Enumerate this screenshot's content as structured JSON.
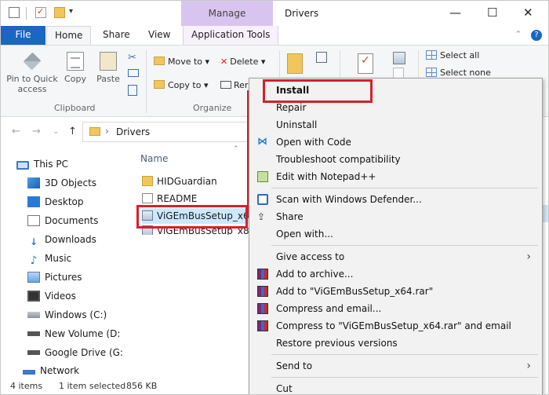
{
  "window": {
    "title": "Drivers",
    "manage_label": "Manage",
    "minimize": "—",
    "maximize": "☐",
    "close": "✕"
  },
  "ribbon_tabs": {
    "file": "File",
    "home": "Home",
    "share": "Share",
    "view": "View",
    "app_tools": "Application Tools"
  },
  "ribbon": {
    "pin": "Pin to Quick access",
    "copy": "Copy",
    "paste": "Paste",
    "move_to": "Move to",
    "delete": "Delete",
    "copy_to": "Copy to",
    "rename": "Rer",
    "select_all": "Select all",
    "select_none": "Select none",
    "group_clipboard": "Clipboard",
    "group_organize": "Organize"
  },
  "address": {
    "path": "Drivers"
  },
  "navpane": {
    "items": [
      {
        "label": "This PC",
        "icon": "computer-icon"
      },
      {
        "label": "3D Objects",
        "icon": "cube-icon"
      },
      {
        "label": "Desktop",
        "icon": "desktop-icon"
      },
      {
        "label": "Documents",
        "icon": "document-icon"
      },
      {
        "label": "Downloads",
        "icon": "download-icon"
      },
      {
        "label": "Music",
        "icon": "music-icon"
      },
      {
        "label": "Pictures",
        "icon": "pictures-icon"
      },
      {
        "label": "Videos",
        "icon": "videos-icon"
      },
      {
        "label": "Windows (C:)",
        "icon": "drive-icon"
      },
      {
        "label": "New Volume (D:",
        "icon": "drive-icon"
      },
      {
        "label": "Google Drive (G:",
        "icon": "drive-icon"
      },
      {
        "label": "Network",
        "icon": "network-icon"
      }
    ]
  },
  "content": {
    "column_name": "Name",
    "files": [
      {
        "name": "HIDGuardian",
        "icon": "folder-icon"
      },
      {
        "name": "README",
        "icon": "text-file-icon"
      },
      {
        "name": "ViGEmBusSetup_x64",
        "icon": "setup-icon"
      },
      {
        "name": "ViGEmBusSetup_x86",
        "icon": "setup-icon"
      }
    ]
  },
  "status": {
    "items_count": "4 items",
    "selected": "1 item selected",
    "size": "856 KB"
  },
  "context_menu": {
    "install": "Install",
    "repair": "Repair",
    "uninstall": "Uninstall",
    "open_with_code": "Open with Code",
    "troubleshoot": "Troubleshoot compatibility",
    "edit_notepad": "Edit with Notepad++",
    "scan_defender": "Scan with Windows Defender...",
    "share": "Share",
    "open_with": "Open with...",
    "give_access": "Give access to",
    "add_archive": "Add to archive...",
    "add_rar": "Add to \"ViGEmBusSetup_x64.rar\"",
    "compress_email": "Compress and email...",
    "compress_rar_email": "Compress to \"ViGEmBusSetup_x64.rar\" and email",
    "restore": "Restore previous versions",
    "send_to": "Send to",
    "cut": "Cut"
  },
  "colors": {
    "accent": "#1967c0",
    "highlight_red": "#d6202a",
    "manage_bg": "#d9c4ef",
    "selection": "#cce8ff"
  }
}
